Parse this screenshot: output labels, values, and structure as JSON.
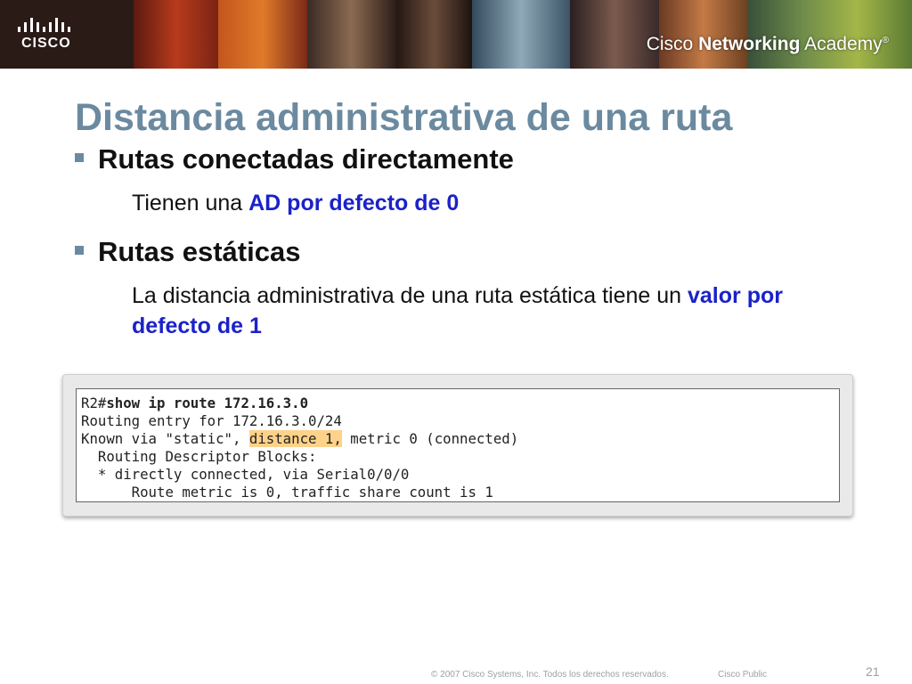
{
  "header": {
    "logo_text": "CISCO",
    "academy_brand_prefix": "Cisco ",
    "academy_brand_bold": "Networking",
    "academy_brand_suffix": " Academy",
    "academy_trademark": "®"
  },
  "slide": {
    "title": "Distancia administrativa de una ruta",
    "bullet1": {
      "heading": "Rutas conectadas directamente",
      "text_before": "Tienen una ",
      "text_highlight": "AD por defecto de 0"
    },
    "bullet2": {
      "heading": "Rutas estáticas",
      "text_before": "La distancia administrativa de una ruta estática tiene un ",
      "text_highlight": "valor por defecto de 1"
    }
  },
  "terminal": {
    "line1_prompt": "R2#",
    "line1_command": "show ip route 172.16.3.0",
    "line2": "Routing entry for 172.16.3.0/24",
    "line3_before": "Known via \"static\", ",
    "line3_highlight": "distance 1,",
    "line3_after": " metric 0 (connected)",
    "line4": "  Routing Descriptor Blocks:",
    "line5": "  * directly connected, via Serial0/0/0",
    "line6": "      Route metric is 0, traffic share count is 1"
  },
  "footer": {
    "copyright": "© 2007 Cisco Systems, Inc. Todos los derechos reservados.",
    "classification": "Cisco Public",
    "page_number": "21"
  },
  "colors": {
    "title": "#6b8aa0",
    "highlight_text": "#1b22c8",
    "terminal_highlight": "#ffd28a",
    "banner": "#2a1b16"
  }
}
